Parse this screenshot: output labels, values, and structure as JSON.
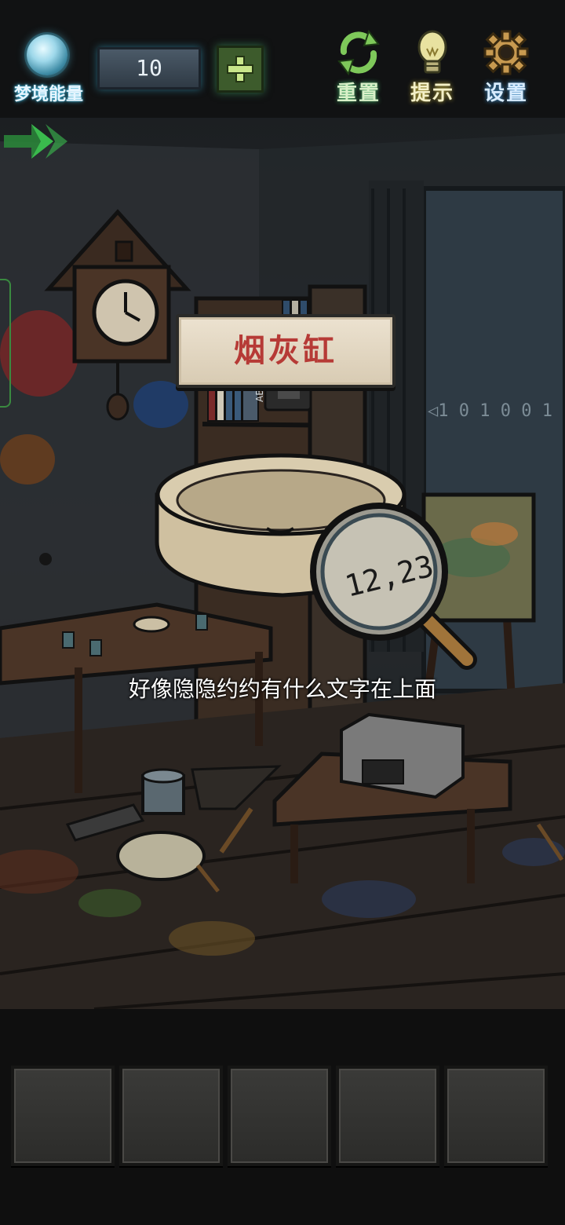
{
  "hud": {
    "energy_label": "梦境能量",
    "energy_count": "10",
    "tools": [
      {
        "label": "重置",
        "icon": "reset-icon"
      },
      {
        "label": "提示",
        "icon": "lightbulb-icon"
      },
      {
        "label": "设置",
        "icon": "gear-icon"
      }
    ]
  },
  "scene": {
    "item_title": "烟灰缸",
    "magnifier_text": "12,23",
    "caption": "好像隐隐约约有什么文字在上面",
    "wall_code": "◁1 0 1 0 0 1",
    "bookshelf_text": "ABC"
  },
  "inventory": {
    "slots": [
      "",
      "",
      "",
      "",
      ""
    ]
  },
  "colors": {
    "title_text": "#b63a36",
    "hud_bg": "#111213",
    "inventory_bg": "#0f0f0f"
  }
}
